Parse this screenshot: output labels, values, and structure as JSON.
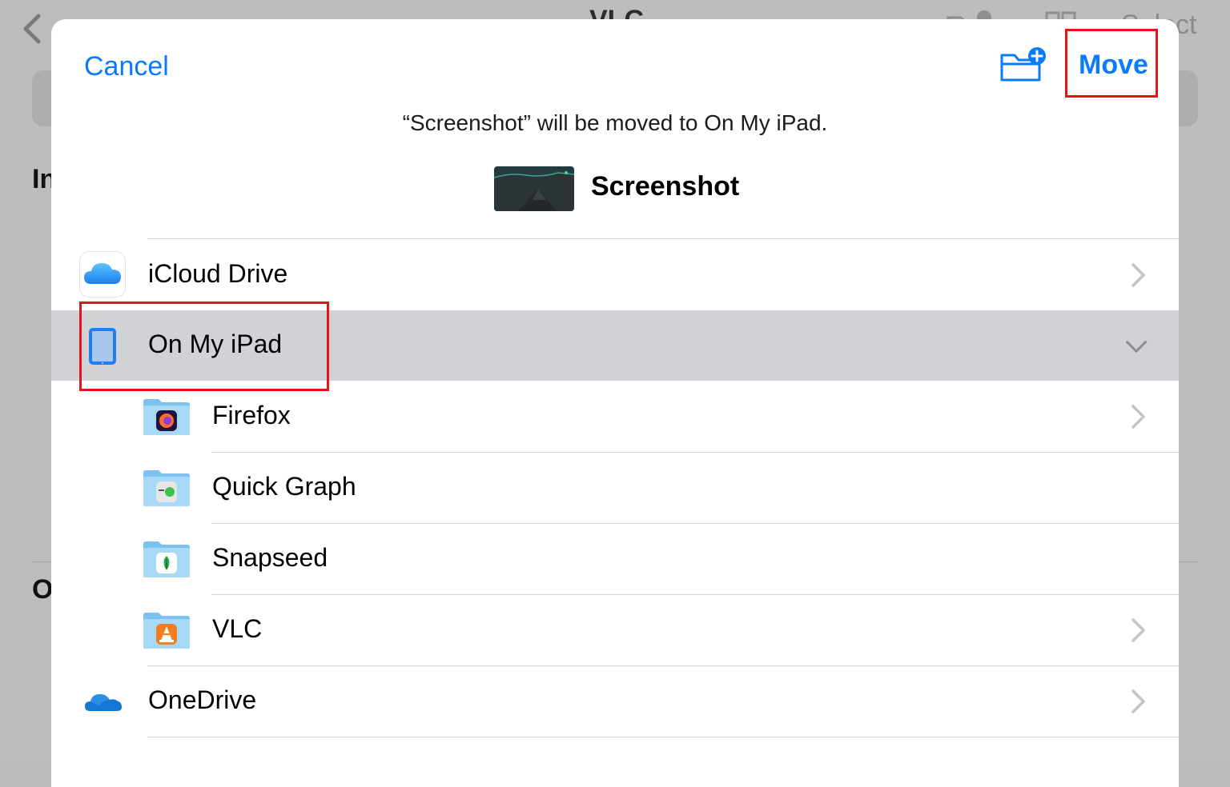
{
  "background": {
    "title": "VLC",
    "select_label": "Select",
    "heading_1": "In",
    "heading_2": "O"
  },
  "toolbar": {
    "cancel_label": "Cancel",
    "move_label": "Move",
    "new_folder_icon": "folder-plus-icon"
  },
  "message": "“Screenshot” will be moved to On My iPad.",
  "item": {
    "name": "Screenshot"
  },
  "locations": [
    {
      "label": "iCloud Drive",
      "icon": "icloud-icon",
      "chevron": "right"
    },
    {
      "label": "On My iPad",
      "icon": "ipad-icon",
      "chevron": "down",
      "selected": true
    },
    {
      "label": "Firefox",
      "icon": "firefox-folder-icon",
      "chevron": "right"
    },
    {
      "label": "Quick Graph",
      "icon": "quick-graph-folder-icon",
      "chevron": "none"
    },
    {
      "label": "Snapseed",
      "icon": "snapseed-folder-icon",
      "chevron": "none"
    },
    {
      "label": "VLC",
      "icon": "vlc-folder-icon",
      "chevron": "right"
    },
    {
      "label": "OneDrive",
      "icon": "onedrive-icon",
      "chevron": "right"
    }
  ],
  "colors": {
    "accent": "#0a7aff",
    "highlight": "#e8131a",
    "selected_row": "#d1d1d6"
  }
}
